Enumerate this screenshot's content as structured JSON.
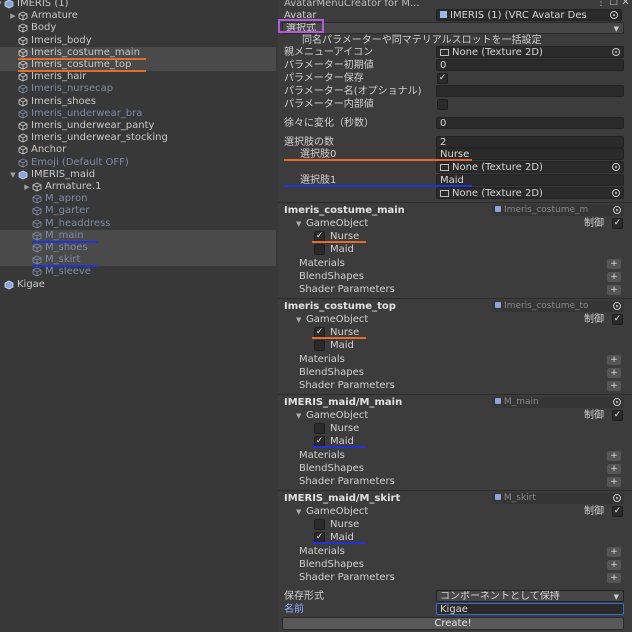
{
  "hierarchy": {
    "items": [
      {
        "label": "IMERIS (1)",
        "indent": 0,
        "arrow": "down",
        "dim": false,
        "root": true
      },
      {
        "label": "Armature",
        "indent": 1,
        "arrow": "right",
        "dim": false
      },
      {
        "label": "Body",
        "indent": 1,
        "arrow": "",
        "dim": false
      },
      {
        "label": "Imeris_body",
        "indent": 1,
        "arrow": "",
        "dim": false
      },
      {
        "label": "Imeris_costume_main",
        "indent": 1,
        "arrow": "",
        "dim": false,
        "sel": true
      },
      {
        "label": "Imeris_costume_top",
        "indent": 1,
        "arrow": "",
        "dim": false,
        "sel": true
      },
      {
        "label": "Imeris_hair",
        "indent": 1,
        "arrow": "",
        "dim": false
      },
      {
        "label": "Imeris_nursecap",
        "indent": 1,
        "arrow": "",
        "dim": true
      },
      {
        "label": "Imeris_shoes",
        "indent": 1,
        "arrow": "",
        "dim": false
      },
      {
        "label": "Imeris_underwear_bra",
        "indent": 1,
        "arrow": "",
        "dim": true
      },
      {
        "label": "Imeris_underwear_panty",
        "indent": 1,
        "arrow": "",
        "dim": false
      },
      {
        "label": "Imeris_underwear_stocking",
        "indent": 1,
        "arrow": "",
        "dim": false
      },
      {
        "label": "Anchor",
        "indent": 1,
        "arrow": "",
        "dim": false
      },
      {
        "label": "Emoji (Default OFF)",
        "indent": 1,
        "arrow": "",
        "dim": true
      },
      {
        "label": "IMERIS_maid",
        "indent": 1,
        "arrow": "down",
        "dim": false,
        "root": true
      },
      {
        "label": "Armature.1",
        "indent": 2,
        "arrow": "right",
        "dim": false
      },
      {
        "label": "M_apron",
        "indent": 2,
        "arrow": "",
        "dim": true
      },
      {
        "label": "M_garter",
        "indent": 2,
        "arrow": "",
        "dim": true
      },
      {
        "label": "M_headdress",
        "indent": 2,
        "arrow": "",
        "dim": true
      },
      {
        "label": "M_main",
        "indent": 2,
        "arrow": "",
        "dim": true,
        "sel": true
      },
      {
        "label": "M_shoes",
        "indent": 2,
        "arrow": "",
        "dim": true,
        "sel": true
      },
      {
        "label": "M_skirt",
        "indent": 2,
        "arrow": "",
        "dim": true,
        "sel": true
      },
      {
        "label": "M_sleeve",
        "indent": 2,
        "arrow": "",
        "dim": true
      },
      {
        "label": "Kigae",
        "indent": 0,
        "arrow": "",
        "dim": false,
        "root": true
      }
    ]
  },
  "inspector": {
    "window_title": "AvatarMenuCreator for M...",
    "avatar_label": "Avatar",
    "avatar_value": "IMERIS (1) (VRC Avatar Des",
    "mode_value": "選択式",
    "bulk_label": "同名パラメーターや同マテリアルスロットを一括設定",
    "parent_icon_label": "親メニューアイコン",
    "parent_icon_value": "None (Texture 2D)",
    "param_init_label": "パラメーター初期値",
    "param_init_value": "0",
    "param_save_label": "パラメーター保存",
    "param_save_check": "✓",
    "param_name_label": "パラメーター名(オプショナル)",
    "param_name_value": "",
    "param_internal_label": "パラメーター内部値",
    "gradual_label": "徐々に変化（秒数）",
    "gradual_value": "0",
    "choice_count_label": "選択肢の数",
    "choice_count_value": "2",
    "choice0_label": "選択肢0",
    "choice0_value": "Nurse",
    "choice0_icon": "None (Texture 2D)",
    "choice1_label": "選択肢1",
    "choice1_value": "Maid",
    "choice1_icon": "None (Texture 2D)",
    "sections": [
      {
        "title": "Imeris_costume_main",
        "obj": "Imeris_costume_m",
        "go": "GameObject",
        "ctrl": "制御",
        "nurse": true,
        "maid": false
      },
      {
        "title": "Imeris_costume_top",
        "obj": "Imeris_costume_to",
        "go": "GameObject",
        "ctrl": "制御",
        "nurse": true,
        "maid": false
      },
      {
        "title": "IMERIS_maid/M_main",
        "obj": "M_main",
        "go": "GameObject",
        "ctrl": "制御",
        "nurse": false,
        "maid": true
      },
      {
        "title": "IMERIS_maid/M_skirt",
        "obj": "M_skirt",
        "go": "GameObject",
        "ctrl": "制御",
        "nurse": false,
        "maid": true
      }
    ],
    "nurse_label": "Nurse",
    "maid_label": "Maid",
    "materials_label": "Materials",
    "blendshapes_label": "BlendShapes",
    "shader_label": "Shader Parameters",
    "save_format_label": "保存形式",
    "save_format_value": "コンポーネントとして保持",
    "name_label": "名前",
    "name_value": "Kigae",
    "create_label": "Create!"
  },
  "colors": {
    "orange": "#e06d2a",
    "blue": "#2332d6",
    "purple": "#b05cd6"
  }
}
